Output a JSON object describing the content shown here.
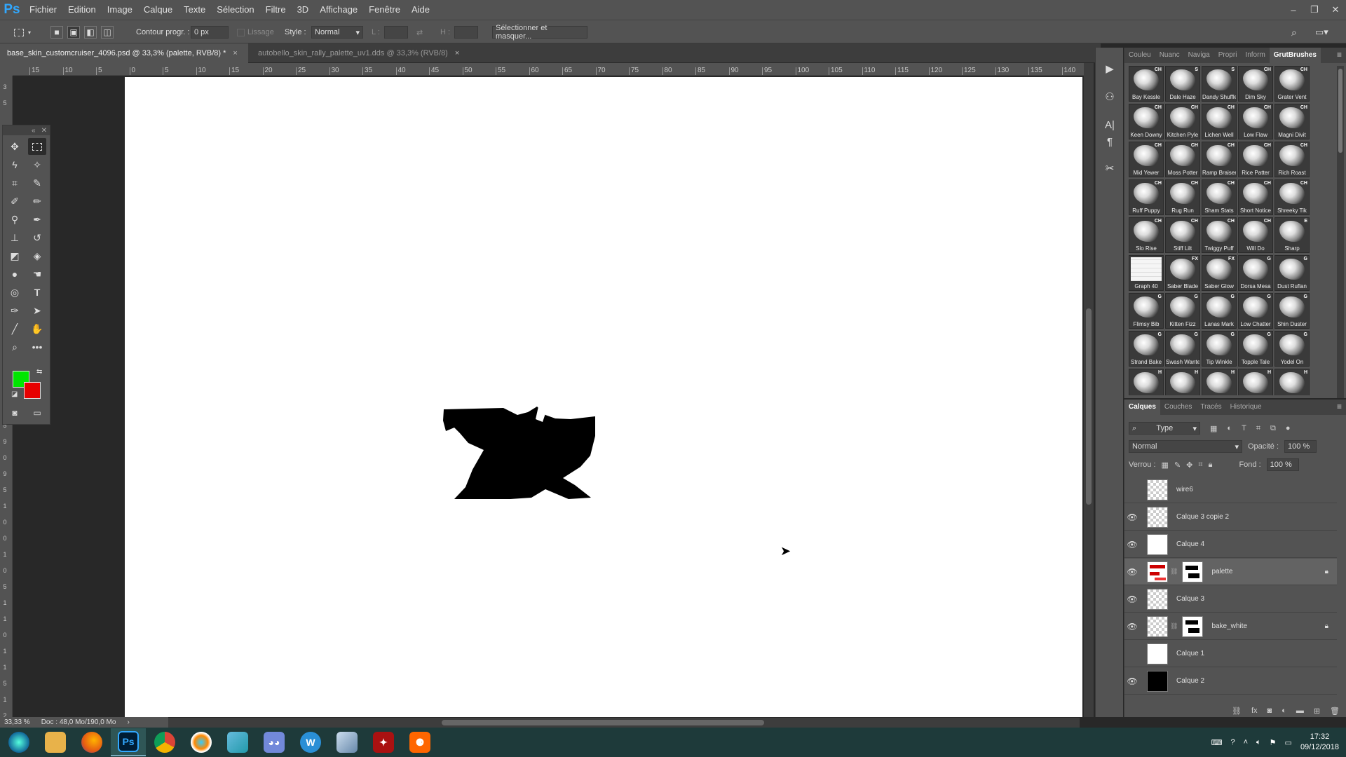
{
  "app": {
    "logo": "Ps"
  },
  "menu": [
    "Fichier",
    "Edition",
    "Image",
    "Calque",
    "Texte",
    "Sélection",
    "Filtre",
    "3D",
    "Affichage",
    "Fenêtre",
    "Aide"
  ],
  "options": {
    "feather_label": "Contour progr. :",
    "feather_value": "0 px",
    "antialias_label": "Lissage",
    "style_label": "Style :",
    "style_value": "Normal",
    "width_label": "L :",
    "height_label": "H :",
    "select_mask_label": "Sélectionner et masquer..."
  },
  "tabs": [
    {
      "label": "base_skin_customcruiser_4096.psd @ 33,3% (palette, RVB/8) *",
      "active": true
    },
    {
      "label": "autobello_skin_rally_palette_uv1.dds @ 33,3% (RVB/8)",
      "active": false
    }
  ],
  "ruler": {
    "h_ticks": [
      "15",
      "10",
      "5",
      "0",
      "5",
      "10",
      "15",
      "20",
      "25",
      "30",
      "35",
      "40",
      "45",
      "50",
      "55",
      "60",
      "65",
      "70",
      "75",
      "80",
      "85",
      "90",
      "95",
      "100",
      "105",
      "110",
      "115",
      "120",
      "125",
      "130",
      "135",
      "140"
    ],
    "v_ticks": [
      "3",
      "5",
      "",
      "",
      "",
      "",
      "",
      "",
      "",
      "",
      "",
      "",
      "",
      "",
      "",
      "",
      "",
      "",
      "",
      "",
      "8",
      "5",
      "9",
      "0",
      "9",
      "5",
      "1",
      "0",
      "0",
      "1",
      "0",
      "5",
      "1",
      "1",
      "0",
      "1",
      "1",
      "5",
      "1",
      "2"
    ]
  },
  "status": {
    "zoom": "33,33 %",
    "doc": "Doc : 48,0 Mo/190,0 Mo"
  },
  "colors": {
    "foreground": "#00e600",
    "background": "#e60000",
    "accent": "#31a8ff"
  },
  "brush_panel": {
    "tabs": [
      "Couleu",
      "Nuanc",
      "Naviga",
      "Propri",
      "Inform",
      "GrutBrushes"
    ],
    "active_tab": "GrutBrushes",
    "brushes": [
      {
        "name": "Bay Kessle",
        "tag": "CH"
      },
      {
        "name": "Dale Haze",
        "tag": "S"
      },
      {
        "name": "Dandy Shuffle",
        "tag": "S"
      },
      {
        "name": "Dim Sky",
        "tag": "CH"
      },
      {
        "name": "Grater Vent",
        "tag": "CH"
      },
      {
        "name": "Keen Downy",
        "tag": "CH"
      },
      {
        "name": "Kitchen Pyle",
        "tag": "CH"
      },
      {
        "name": "Lichen Well",
        "tag": "CH"
      },
      {
        "name": "Low Flaw",
        "tag": "CH"
      },
      {
        "name": "Magni Divit",
        "tag": "CH"
      },
      {
        "name": "Mid Yewer",
        "tag": "CH"
      },
      {
        "name": "Moss Potter",
        "tag": "CH"
      },
      {
        "name": "Ramp Braiser",
        "tag": "CH"
      },
      {
        "name": "Rice Patter",
        "tag": "CH"
      },
      {
        "name": "Rich Roast",
        "tag": "CH"
      },
      {
        "name": "Ruff Puppy",
        "tag": "CH"
      },
      {
        "name": "Rug Run",
        "tag": "CH"
      },
      {
        "name": "Sham Stats",
        "tag": "CH"
      },
      {
        "name": "Short Notice",
        "tag": "CH"
      },
      {
        "name": "Shreeky Tik",
        "tag": "CH"
      },
      {
        "name": "Slo Rise",
        "tag": "CH"
      },
      {
        "name": "Stiff Lilt",
        "tag": "CH"
      },
      {
        "name": "Twiggy Puff",
        "tag": "CH"
      },
      {
        "name": "Will Do",
        "tag": "CH"
      },
      {
        "name": "Sharp",
        "tag": "E"
      },
      {
        "name": "Graph 40",
        "tag": ""
      },
      {
        "name": "Saber Blade",
        "tag": "FX"
      },
      {
        "name": "Saber Glow",
        "tag": "FX"
      },
      {
        "name": "Dorsa Mesa",
        "tag": "G"
      },
      {
        "name": "Dust Ruflan",
        "tag": "G"
      },
      {
        "name": "Flimsy Bib",
        "tag": "G"
      },
      {
        "name": "Kitten Fizz",
        "tag": "G"
      },
      {
        "name": "Lanas Mark",
        "tag": "G"
      },
      {
        "name": "Low Chatter",
        "tag": "G"
      },
      {
        "name": "Shin Duster",
        "tag": "G"
      },
      {
        "name": "Strand Bake",
        "tag": "G"
      },
      {
        "name": "Swash Wanted",
        "tag": "G"
      },
      {
        "name": "Tip Winkle",
        "tag": "G"
      },
      {
        "name": "Topple Tale",
        "tag": "G"
      },
      {
        "name": "Yodel On",
        "tag": "G"
      },
      {
        "name": "",
        "tag": "H"
      },
      {
        "name": "",
        "tag": "H"
      },
      {
        "name": "",
        "tag": "H"
      },
      {
        "name": "",
        "tag": "H"
      },
      {
        "name": "",
        "tag": "H"
      }
    ]
  },
  "layers_panel": {
    "tabs": [
      "Calques",
      "Couches",
      "Tracés",
      "Historique"
    ],
    "filter_label": "Type",
    "blend_mode": "Normal",
    "opacity_label": "Opacité :",
    "opacity_value": "100 %",
    "lock_label": "Verrou :",
    "fill_label": "Fond :",
    "fill_value": "100 %",
    "layers": [
      {
        "name": "wire6",
        "visible": false,
        "thumb": "checker",
        "mask": false,
        "locked": false,
        "selected": false
      },
      {
        "name": "Calque 3 copie 2",
        "visible": true,
        "thumb": "checker",
        "mask": false,
        "locked": false,
        "selected": false
      },
      {
        "name": "Calque 4",
        "visible": true,
        "thumb": "white",
        "mask": false,
        "locked": false,
        "selected": false
      },
      {
        "name": "palette",
        "visible": true,
        "thumb": "red",
        "mask": true,
        "locked": true,
        "selected": true
      },
      {
        "name": "Calque 3",
        "visible": true,
        "thumb": "checker",
        "mask": false,
        "locked": false,
        "selected": false
      },
      {
        "name": "bake_white",
        "visible": true,
        "thumb": "checker",
        "mask": true,
        "locked": true,
        "selected": false
      },
      {
        "name": "Calque 1",
        "visible": false,
        "thumb": "white",
        "mask": false,
        "locked": false,
        "selected": false
      },
      {
        "name": "Calque 2",
        "visible": true,
        "thumb": "black",
        "mask": false,
        "locked": false,
        "selected": false
      }
    ]
  },
  "taskbar": {
    "apps": [
      "start",
      "explorer",
      "firefox",
      "photoshop",
      "chrome",
      "app-eye",
      "app-file",
      "discord",
      "app-w",
      "app-tool",
      "app-game",
      "app-orange"
    ],
    "active": "photoshop",
    "time": "17:32",
    "date": "09/12/2018"
  }
}
